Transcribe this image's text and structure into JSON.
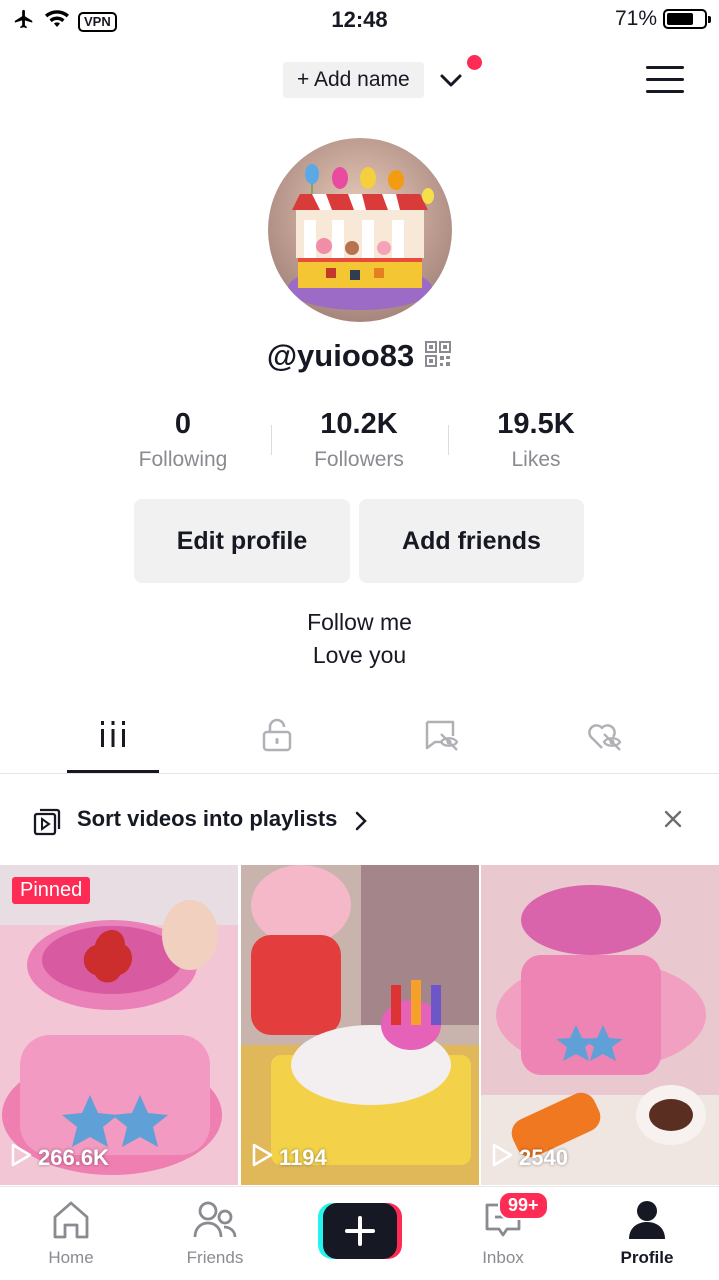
{
  "status_bar": {
    "time": "12:48",
    "vpn_label": "VPN",
    "battery_percent": "71%",
    "battery_level": 0.71
  },
  "header": {
    "add_name_label": "+ Add name",
    "notification_color": "#fe2c55"
  },
  "profile": {
    "username": "@yuioo83",
    "stats": [
      {
        "value": "0",
        "label": "Following"
      },
      {
        "value": "10.2K",
        "label": "Followers"
      },
      {
        "value": "19.5K",
        "label": "Likes"
      }
    ],
    "edit_profile_label": "Edit profile",
    "add_friends_label": "Add friends",
    "bio_line1": "Follow me",
    "bio_line2": "Love you"
  },
  "tabs": {
    "items": [
      "videos-grid-icon",
      "lock-icon",
      "repost-hidden-icon",
      "liked-hidden-icon"
    ],
    "active_index": 0
  },
  "playlist_banner": {
    "text": "Sort videos into playlists"
  },
  "videos": [
    {
      "pinned_label": "Pinned",
      "views": "266.6K"
    },
    {
      "views": "1194"
    },
    {
      "views": "2540"
    }
  ],
  "bottom_nav": {
    "home_label": "Home",
    "friends_label": "Friends",
    "inbox_label": "Inbox",
    "inbox_badge": "99+",
    "profile_label": "Profile"
  },
  "colors": {
    "accent": "#fe2c55",
    "text": "#161823",
    "secondary_text": "#8a8b91"
  }
}
